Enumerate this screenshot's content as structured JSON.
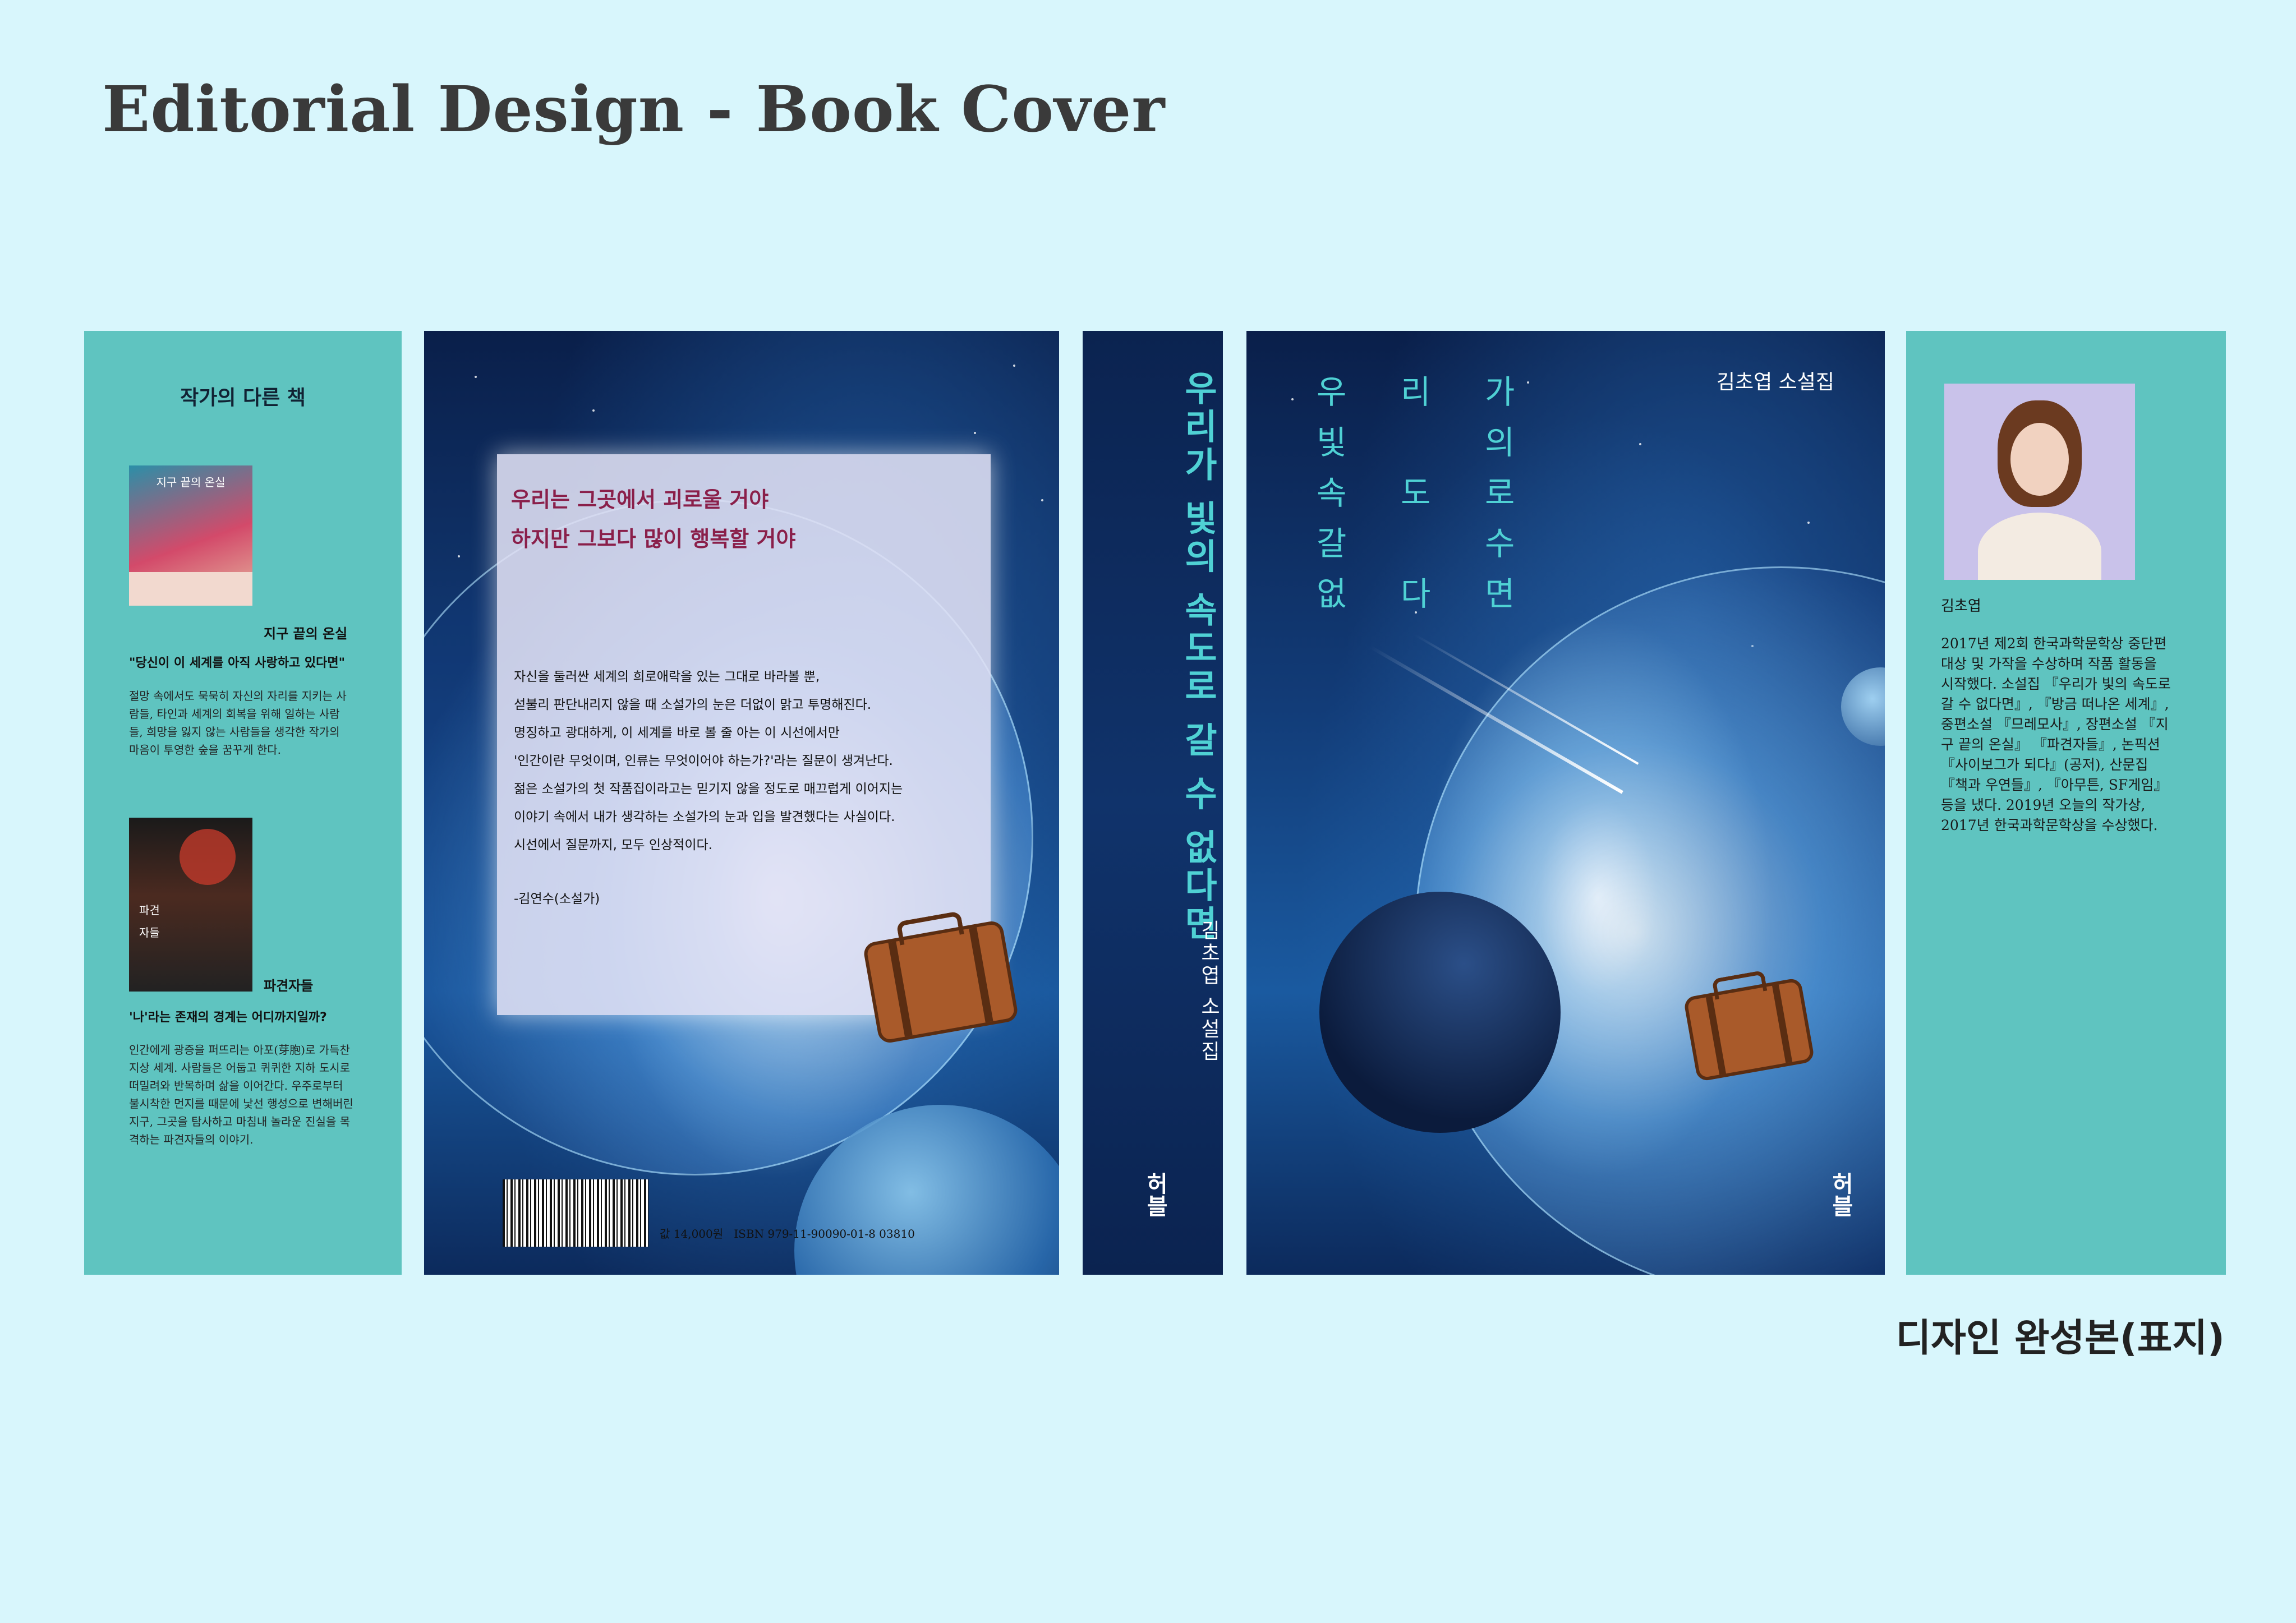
{
  "header": {
    "title": "Editorial Design - Book Cover"
  },
  "caption": "디자인 완성본(표지)",
  "left_flap": {
    "title": "작가의 다른 책",
    "book1": {
      "cover_title": "지구 끝의 온실",
      "name": "지구 끝의 온실",
      "quote": "\"당신이 이 세계를 아직 사랑하고 있다면\"",
      "body": "절망 속에서도 묵묵히 자신의 자리를 지키는 사람들, 타인과 세계의 회복을 위해 일하는 사람들, 희망을 잃지 않는 사람들을 생각한 작가의 마음이 투영한 숲을 꿈꾸게 한다."
    },
    "book2": {
      "cover_title": "파견자들",
      "name": "파견자들",
      "quote": "'나'라는 존재의 경계는 어디까지일까?",
      "body": "인간에게 광증을 퍼뜨리는 아포(芽胞)로 가득찬 지상 세계. 사람들은 어둡고 퀴퀴한 지하 도시로 떠밀려와 반목하며 삶을 이어간다. 우주로부터 불시착한 먼지를 때문에 낯선 행성으로 변해버린 지구, 그곳을 탐사하고 마침내 놀라운 진실을 목격하는 파견자들의 이야기."
    }
  },
  "back_cover": {
    "quote_line1": "우리는 그곳에서 괴로울 거야",
    "quote_line2": "하지만 그보다 많이 행복할 거야",
    "review": [
      "자신을 둘러싼 세계의 희로애락을 있는 그대로 바라볼 뿐,",
      "섣불리 판단내리지 않을 때 소설가의 눈은 더없이 맑고 투명해진다.",
      "명징하고 광대하게, 이 세계를 바로 볼 줄 아는 이 시선에서만",
      "'인간이란 무엇이며, 인류는 무엇이어야 하는가?'라는 질문이 생겨난다.",
      "젊은 소설가의 첫 작품집이라고는 믿기지 않을 정도로 매끄럽게 이어지는",
      "이야기 속에서 내가 생각하는 소설가의 눈과 입을 발견했다는 사실이다.",
      "시선에서 질문까지, 모두 인상적이다."
    ],
    "signature": "-김연수(소설가)",
    "price": "값 14,000원",
    "isbn": "ISBN 979-11-90090-01-8 03810"
  },
  "spine": {
    "title": "우리가 빛의 속도로 갈 수 없다면",
    "author": "김초엽 소설집",
    "publisher": "허블"
  },
  "front_cover": {
    "author": "김초엽 소설집",
    "title_chars": [
      "우",
      "빛",
      "속",
      "갈",
      "없",
      "리",
      "도",
      "다",
      "가",
      "의",
      "로",
      "수",
      "면"
    ],
    "publisher": "허블"
  },
  "right_flap": {
    "author_name": "김초엽",
    "bio": "2017년 제2회 한국과학문학상 중단편 대상 및 가작을 수상하며 작품 활동을 시작했다. 소설집 『우리가 빛의 속도로 갈 수 없다면』, 『방금 떠나온 세계』, 중편소설 『므레모사』, 장편소설 『지구 끝의 온실』 『파견자들』, 논픽션 『사이보그가 되다』(공저), 산문집 『책과 우연들』, 『아무튼, SF게임』 등을 냈다. 2019년 오늘의 작가상, 2017년 한국과학문학상을 수상했다."
  },
  "colors": {
    "background": "#d8f6fc",
    "flap": "#5fc4c0",
    "title_accent": "#4fd1d4",
    "quote_accent": "#8a1f4a"
  }
}
